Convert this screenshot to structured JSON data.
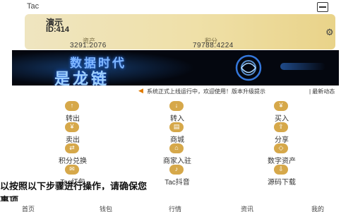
{
  "header": {
    "title": "Tac",
    "scan_icon": "scan-icon"
  },
  "wallet": {
    "name": "演示",
    "id": "ID:414",
    "settings_icon": "gear-icon",
    "stats": [
      {
        "label": "资产",
        "value": "3291.2076"
      },
      {
        "label": "积分",
        "value": "79788.4224"
      }
    ]
  },
  "banner": {
    "title": "数据时代",
    "subtitle": "是龙链"
  },
  "notice": {
    "icon": "speaker-icon",
    "text": "系统正式上线运行中，欢迎使用！版本升级提示",
    "more": "| 最新动态"
  },
  "grid": [
    {
      "label": "转出",
      "icon": "transfer-out-icon",
      "glyph": "↑"
    },
    {
      "label": "转入",
      "icon": "transfer-in-icon",
      "glyph": "↓"
    },
    {
      "label": "买入",
      "icon": "buy-icon",
      "glyph": "¥"
    },
    {
      "label": "卖出",
      "icon": "sell-icon",
      "glyph": "¥"
    },
    {
      "label": "商城",
      "icon": "mall-icon",
      "glyph": "▤"
    },
    {
      "label": "分享",
      "icon": "share-icon",
      "glyph": "⇪"
    },
    {
      "label": "积分兑换",
      "icon": "points-exchange-icon",
      "glyph": "⇄"
    },
    {
      "label": "商家入驻",
      "icon": "merchant-icon",
      "glyph": "⌂"
    },
    {
      "label": "数字资产",
      "icon": "digital-asset-icon",
      "glyph": "◇"
    },
    {
      "label": "Tac红包",
      "icon": "red-packet-icon",
      "glyph": "✉"
    },
    {
      "label": "Tac抖音",
      "icon": "video-icon",
      "glyph": "♪"
    },
    {
      "label": "源码下载",
      "icon": "download-icon",
      "glyph": "⇩"
    }
  ],
  "overlay": {
    "line1": "以按照以下步骤进行操作，请确保您",
    "line2": "事项"
  },
  "tabbar": [
    {
      "label": "首页",
      "icon": "home-icon"
    },
    {
      "label": "钱包",
      "icon": "wallet-icon"
    },
    {
      "label": "行情",
      "icon": "market-icon"
    },
    {
      "label": "资讯",
      "icon": "news-icon"
    },
    {
      "label": "我的",
      "icon": "profile-icon"
    }
  ],
  "colors": {
    "card_gold": "#efe0a8",
    "icon_gold": "#d6a84a",
    "banner_bg": "#04070f",
    "banner_text": "#9fd0ff"
  }
}
